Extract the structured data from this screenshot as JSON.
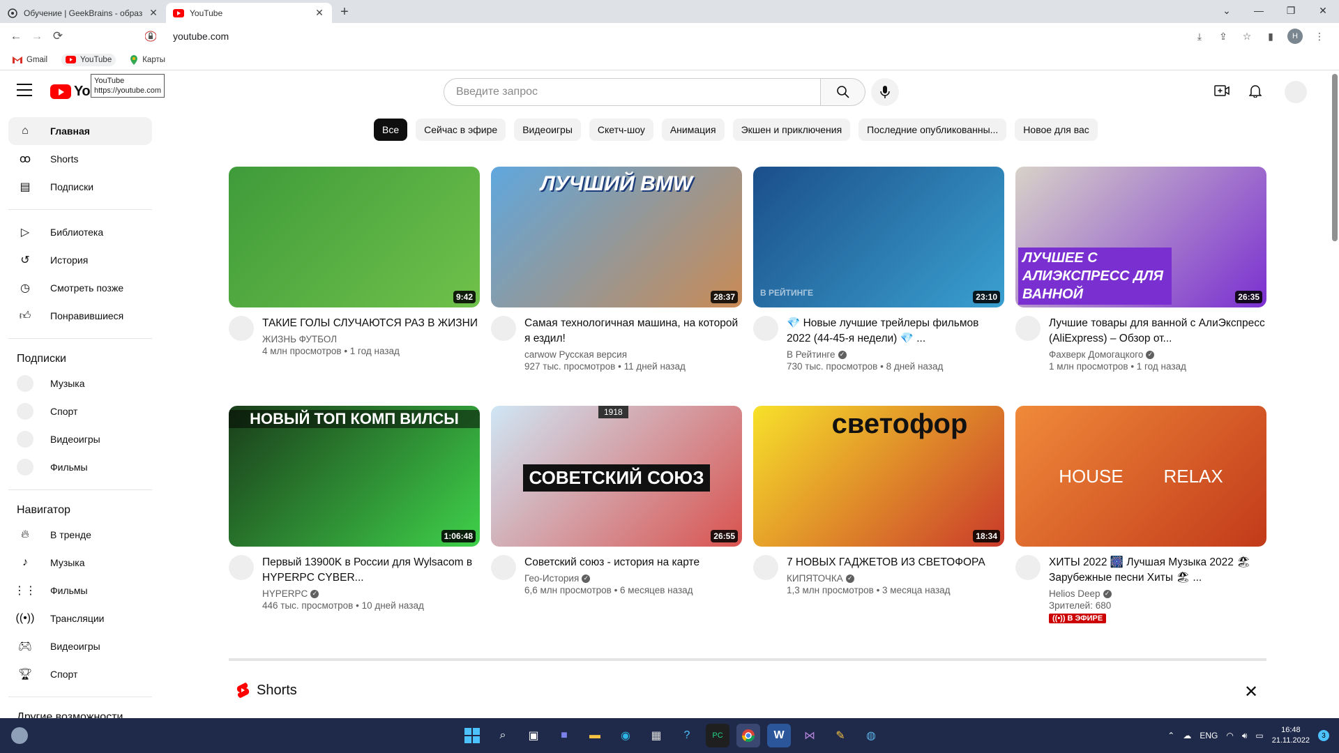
{
  "browser": {
    "tabs": [
      {
        "title": "Обучение | GeekBrains - образо",
        "active": false,
        "icon": "geekbrains-icon"
      },
      {
        "title": "YouTube",
        "active": true,
        "icon": "youtube-icon"
      }
    ],
    "new_tab": "+",
    "address": "youtube.com",
    "bookmarks": [
      {
        "label": "Gmail",
        "icon": "gmail-icon"
      },
      {
        "label": "YouTube",
        "icon": "youtube-icon"
      },
      {
        "label": "Карты",
        "icon": "maps-icon"
      }
    ],
    "profile_initial": "Н"
  },
  "youtube": {
    "tooltip": {
      "line1": "YouTube",
      "line2": "https://youtube.com"
    },
    "logo_text": "YouTube",
    "search_placeholder": "Введите запрос",
    "sidebar": {
      "main": [
        {
          "label": "Главная",
          "icon": "home-icon",
          "active": true
        },
        {
          "label": "Shorts",
          "icon": "shorts-icon"
        },
        {
          "label": "Подписки",
          "icon": "subscriptions-icon"
        }
      ],
      "library": [
        {
          "label": "Библиотека",
          "icon": "library-icon"
        },
        {
          "label": "История",
          "icon": "history-icon"
        },
        {
          "label": "Смотреть позже",
          "icon": "watch-later-icon"
        },
        {
          "label": "Понравившиеся",
          "icon": "like-icon"
        }
      ],
      "subscriptions_title": "Подписки",
      "subscriptions": [
        "Музыка",
        "Спорт",
        "Видеоигры",
        "Фильмы"
      ],
      "navigator_title": "Навигатор",
      "navigator": [
        {
          "label": "В тренде",
          "icon": "trending-icon"
        },
        {
          "label": "Музыка",
          "icon": "music-icon"
        },
        {
          "label": "Фильмы",
          "icon": "film-icon"
        },
        {
          "label": "Трансляции",
          "icon": "live-icon"
        },
        {
          "label": "Видеоигры",
          "icon": "gaming-icon"
        },
        {
          "label": "Спорт",
          "icon": "trophy-icon"
        }
      ],
      "more_title": "Другие возможности"
    },
    "chips": [
      "Все",
      "Сейчас в эфире",
      "Видеоигры",
      "Скетч-шоу",
      "Анимация",
      "Экшен и приключения",
      "Последние опубликованны...",
      "Новое для вас"
    ],
    "videos": [
      {
        "title": "ТАКИЕ ГОЛЫ СЛУЧАЮТСЯ РАЗ В ЖИЗНИ",
        "channel": "ЖИЗНЬ ФУТБОЛ",
        "verified": false,
        "stats": "4 млн просмотров • 1 год назад",
        "duration": "9:42",
        "thumb_text": "",
        "colors": [
          "#3f9b3a",
          "#6fc14a"
        ]
      },
      {
        "title": "Самая технологичная машина, на которой я ездил!",
        "channel": "carwow Русская версия",
        "verified": false,
        "stats": "927 тыс. просмотров • 11 дней назад",
        "duration": "28:37",
        "thumb_text": "ЛУЧШИЙ BMW",
        "colors": [
          "#5fa7de",
          "#c98a55"
        ]
      },
      {
        "title": "💎 Новые лучшие трейлеры фильмов 2022 (44-45-я недели) 💎 ...",
        "channel": "В Рейтинге",
        "verified": true,
        "stats": "730 тыс. просмотров • 8 дней назад",
        "duration": "23:10",
        "thumb_text": "В РЕЙТИНГЕ",
        "colors": [
          "#1b4f8a",
          "#3aa0d0"
        ]
      },
      {
        "title": "Лучшие товары для ванной с АлиЭкспресс (AliExpress) – Обзор от...",
        "channel": "Фахверк Домогацкого",
        "verified": true,
        "stats": "1 млн просмотров • 1 год назад",
        "duration": "26:35",
        "thumb_text": "ЛУЧШЕЕ С АЛИЭКСПРЕСС ДЛЯ ВАННОЙ",
        "colors": [
          "#d8d2c8",
          "#7a2fd0"
        ]
      },
      {
        "title": "Первый 13900K в России для Wylsacom в HYPERPC CYBER...",
        "channel": "HYPERPC",
        "verified": true,
        "stats": "446 тыс. просмотров • 10 дней назад",
        "duration": "1:06:48",
        "thumb_text": "НОВЫЙ ТОП КОМП ВИЛСЫ",
        "colors": [
          "#1a3d1a",
          "#3fd14a"
        ]
      },
      {
        "title": "Советский союз - история на карте",
        "channel": "Гео-История",
        "verified": true,
        "stats": "6,6 млн просмотров • 6 месяцев назад",
        "duration": "26:55",
        "thumb_text": "СОВЕТСКИЙ СОЮЗ",
        "year": "1918",
        "colors": [
          "#cfe6f5",
          "#d9534f"
        ]
      },
      {
        "title": "7 НОВЫХ ГАДЖЕТОВ ИЗ СВЕТОФОРА",
        "channel": "КИПЯТОЧКА",
        "verified": true,
        "stats": "1,3 млн просмотров • 3 месяца назад",
        "duration": "18:34",
        "thumb_text": "светофор",
        "colors": [
          "#f7e12a",
          "#c93a2a"
        ]
      },
      {
        "title": "ХИТЫ 2022 🎆 Лучшая Музыка 2022 🏖 Зарубежные песни Хиты 🏖 ...",
        "channel": "Helios Deep",
        "verified": true,
        "stats": "Зрителей: 680",
        "duration": "",
        "live": "((•)) В ЭФИРЕ",
        "thumb_text": "HOUSE        RELAX",
        "colors": [
          "#f08a3a",
          "#c23a1a"
        ]
      }
    ],
    "shorts_title": "Shorts"
  },
  "taskbar": {
    "lang": "ENG",
    "time": "16:48",
    "date": "21.11.2022",
    "notifications": "3"
  }
}
